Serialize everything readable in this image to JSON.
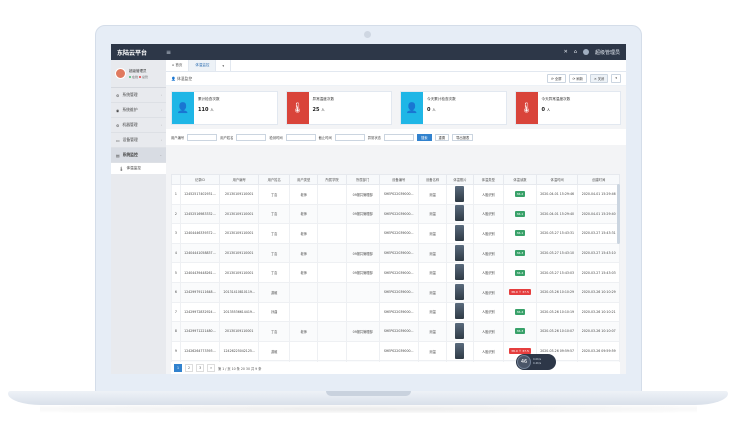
{
  "app": {
    "title": "东陆云平台",
    "menu_icon": "hamburger-icon"
  },
  "topbar": {
    "close": "✕",
    "home": "⌂",
    "user": "超级管理员"
  },
  "sidebar": {
    "user": {
      "name": "超级管理员",
      "online": "在线",
      "admin": "总管"
    },
    "items": [
      {
        "label": "系统管理"
      },
      {
        "label": "系统维护"
      },
      {
        "label": "机器管理"
      },
      {
        "label": "设备管理"
      },
      {
        "label": "系统监控"
      }
    ],
    "sub": {
      "label": "体温监控"
    }
  },
  "tabs": [
    {
      "label": "⌂ 首页"
    },
    {
      "label": "体温监控"
    },
    {
      "label": "▾"
    }
  ],
  "toolbar": {
    "title": "体温监控",
    "buttons": [
      {
        "label": "⟳ 全屏"
      },
      {
        "label": "⟳ 刷新"
      },
      {
        "label": "✕ 关闭"
      },
      {
        "label": "▾"
      }
    ]
  },
  "cards": [
    {
      "label": "累计检查次数",
      "value": "110",
      "unit": "人"
    },
    {
      "label": "异常温度次数",
      "value": "25",
      "unit": "人"
    },
    {
      "label": "今天累计检查次数",
      "value": "0",
      "unit": "人"
    },
    {
      "label": "今天异常温度次数",
      "value": "0",
      "unit": "人"
    }
  ],
  "filters": {
    "labels": [
      "用户编号",
      "用户姓名",
      "检测时间",
      "截止时间",
      "异常状态"
    ],
    "search": "搜索",
    "reset": "重置",
    "export": "导出报表"
  },
  "table": {
    "headers": [
      "",
      "记录ID",
      "用户编号",
      "用户姓名",
      "用户类型",
      "所属学院",
      "所属部门",
      "设备编号",
      "设备名称",
      "体温照片",
      "体温类型",
      "体温读数",
      "体温时间",
      "创建时间"
    ],
    "rows": [
      [
        "1",
        "12452517402931...",
        "20130109110001",
        "丁嘉",
        "老师",
        "",
        "09报共管理部",
        "SHEP022039000...",
        "测温",
        "",
        "人脸识别",
        "36.2",
        "2020-04-01 15:29:46",
        "2020-04-01 15:29:46"
      ],
      [
        "2",
        "12452516983332...",
        "20130109110001",
        "丁嘉",
        "老师",
        "",
        "09报共管理部",
        "SHEP022039000...",
        "测温",
        "",
        "人脸识别",
        "36.1",
        "2020-04-01 15:29:40",
        "2020-04-01 15:29:40"
      ],
      [
        "3",
        "12404446339372...",
        "20130109110001",
        "丁嘉",
        "老师",
        "",
        "",
        "SHEP022039000...",
        "测温",
        "",
        "人脸识别",
        "36.1",
        "2020-03-27 15:43:31",
        "2020-03-27 15:43:31"
      ],
      [
        "4",
        "12404441058837...",
        "20130109110001",
        "丁嘉",
        "老师",
        "",
        "09报共管理部",
        "SHEP022039000...",
        "测温",
        "",
        "人脸识别",
        "36.3",
        "2020-03-27 15:43:10",
        "2020-03-27 15:43:10"
      ],
      [
        "5",
        "12404439448261...",
        "20130109110001",
        "丁嘉",
        "老师",
        "",
        "09报共管理部",
        "SHEP022039000...",
        "测温",
        "",
        "人脸识别",
        "36.4",
        "2020-03-27 15:43:03",
        "2020-03-27 15:43:03"
      ],
      [
        "6",
        "12429979111648...",
        "20131410810119...",
        "游维",
        "",
        "",
        "",
        "SHEP022039000...",
        "测温",
        "",
        "人脸识别",
        "38.0 ↑ 37.5",
        "2020-03-26 10:10:29",
        "2020-03-26 10:10:29"
      ],
      [
        "7",
        "12429972832924...",
        "20135536614419...",
        "孙曲",
        "",
        "",
        "",
        "SHEP022039000...",
        "测温",
        "",
        "人脸识别",
        "36.4",
        "2020-03-26 10:10:19",
        "2020-03-26 10:10:21"
      ],
      [
        "8",
        "12429971221480...",
        "20130109110001",
        "丁嘉",
        "老师",
        "",
        "09报共管理部",
        "SHEP022039000...",
        "测温",
        "",
        "人脸识别",
        "36.3",
        "2020-03-26 10:10:07",
        "2020-03-26 10:10:07"
      ],
      [
        "9",
        "12426264773393...",
        "12426225042125...",
        "游维",
        "",
        "",
        "",
        "SHEP022039000...",
        "测温",
        "",
        "人脸识别",
        "38.0 ↑ 37.5",
        "2020-03-26 09:59:57",
        "2020-03-26 09:59:59"
      ],
      [
        "10",
        "12426263539752...",
        "12426225042125...",
        "游维",
        "",
        "",
        "",
        "SHEP022039000...",
        "测温",
        "",
        "人脸识别",
        "36.4",
        "2020-03-26 09:59:45",
        "2020-03-26 09:59:45"
      ]
    ]
  },
  "pager": {
    "pages": [
      "1",
      "2",
      "3",
      "»"
    ],
    "info": "第 1 / 页 10 条 20 30 共 9 条"
  },
  "widget": {
    "value": "46",
    "up": "0.0K/s",
    "down": "0.4K/s"
  },
  "colors": {
    "topbar": "#2d3748",
    "accent_blue": "#1fb6e6",
    "accent_red": "#d9443a",
    "ok": "#38a169",
    "hot": "#e53e3e"
  }
}
